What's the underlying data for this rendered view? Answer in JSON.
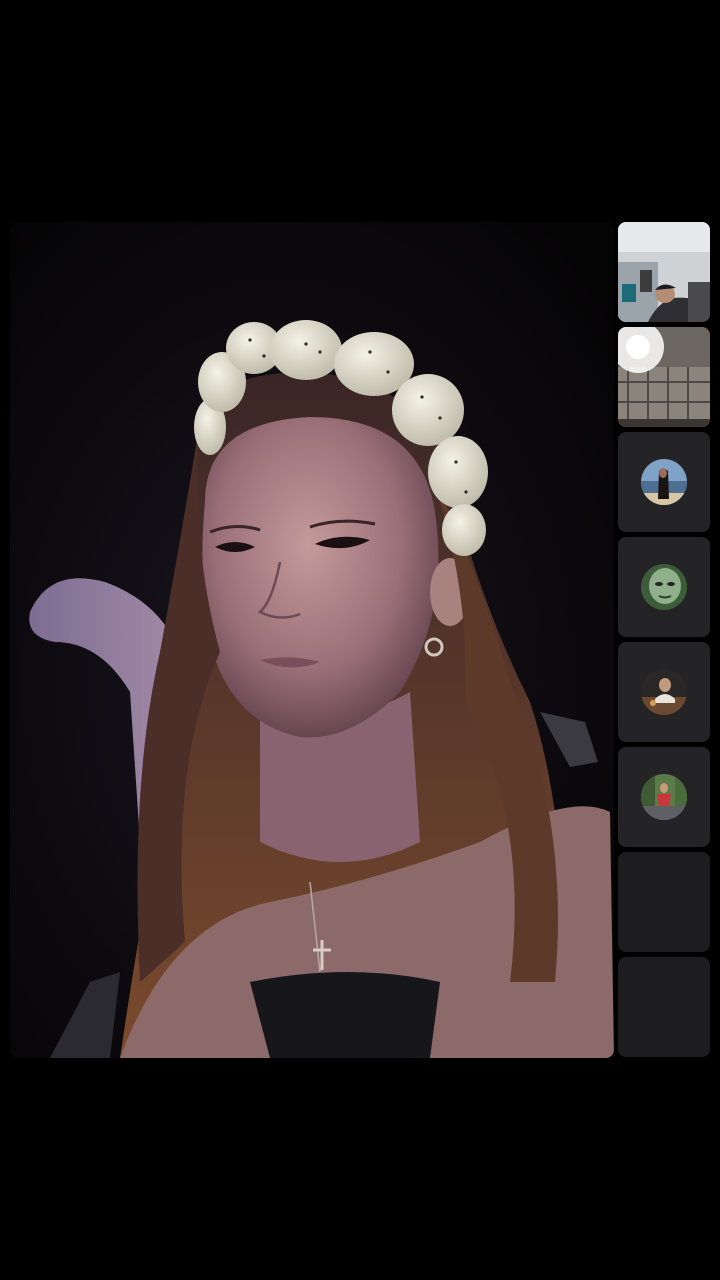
{
  "call": {
    "main_participant": {
      "label": "main-video-feed"
    },
    "participants": [
      {
        "id": "p1",
        "kind": "video",
        "scene": "room-with-person-reclining"
      },
      {
        "id": "p2",
        "kind": "video",
        "scene": "ceiling-light-room"
      },
      {
        "id": "p3",
        "kind": "avatar",
        "scene": "person-at-beach"
      },
      {
        "id": "p4",
        "kind": "avatar",
        "scene": "green-face-portrait"
      },
      {
        "id": "p5",
        "kind": "avatar",
        "scene": "person-seated-at-table"
      },
      {
        "id": "p6",
        "kind": "avatar",
        "scene": "person-outdoors-red-shirt"
      },
      {
        "id": "p7",
        "kind": "empty"
      },
      {
        "id": "p8",
        "kind": "empty"
      }
    ]
  },
  "colors": {
    "background": "#000000",
    "tile": "#242426",
    "empty_tile": "#1d1d1f"
  }
}
